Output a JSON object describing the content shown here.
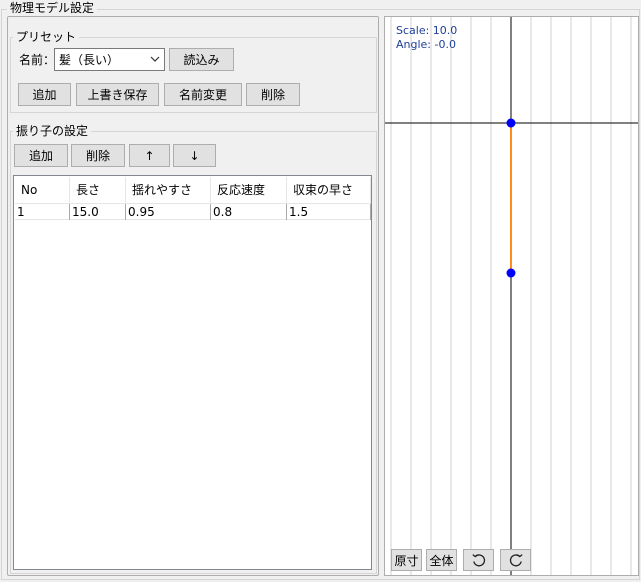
{
  "window": {
    "title": "物理モデル設定"
  },
  "preset": {
    "title": "プリセット",
    "name_label": "名前：",
    "selected_name": "髪（長い）",
    "load_label": "読込み",
    "add_label": "追加",
    "overwrite_label": "上書き保存",
    "rename_label": "名前変更",
    "delete_label": "削除"
  },
  "pendulum": {
    "title": "振り子の設定",
    "add_label": "追加",
    "delete_label": "削除",
    "up_label": "↑",
    "down_label": "↓",
    "columns": [
      "No",
      "長さ",
      "揺れやすさ",
      "反応速度",
      "収束の早さ"
    ],
    "rows": [
      [
        "1",
        "15.0",
        "0.95",
        "0.8",
        "1.5"
      ]
    ]
  },
  "preview": {
    "scale_text": "Scale: 10.0",
    "angle_text": "Angle: -0.0",
    "original_size_label": "原寸",
    "fit_all_label": "全体",
    "rotate_ccw_icon": "rotate-ccw-icon",
    "rotate_cw_icon": "rotate-cw-icon",
    "colors": {
      "node": "#0000ff",
      "segment": "#ff8c1a",
      "axis": "#000000",
      "grid": "#d0d0d0"
    }
  }
}
